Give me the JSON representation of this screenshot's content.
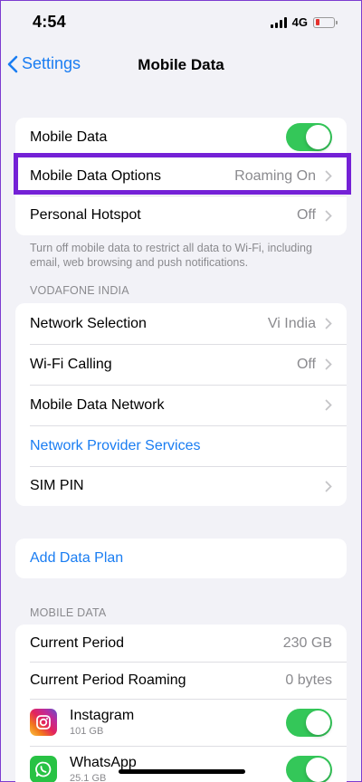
{
  "status_bar": {
    "time": "4:54",
    "network": "4G"
  },
  "nav": {
    "back_label": "Settings",
    "title": "Mobile Data"
  },
  "group1": {
    "rows": [
      {
        "label": "Mobile Data",
        "toggle": "on"
      },
      {
        "label": "Mobile Data Options",
        "value": "Roaming On"
      },
      {
        "label": "Personal Hotspot",
        "value": "Off"
      }
    ],
    "footnote": "Turn off mobile data to restrict all data to Wi-Fi, including email, web browsing and push notifications."
  },
  "carrier_section": {
    "header": "VODAFONE INDIA",
    "rows": [
      {
        "label": "Network Selection",
        "value": "Vi India"
      },
      {
        "label": "Wi-Fi Calling",
        "value": "Off"
      },
      {
        "label": "Mobile Data Network"
      },
      {
        "label": "Network Provider Services"
      },
      {
        "label": "SIM PIN"
      }
    ]
  },
  "data_plan": {
    "label": "Add Data Plan"
  },
  "usage_section": {
    "header": "MOBILE DATA",
    "rows": [
      {
        "label": "Current Period",
        "value": "230 GB"
      },
      {
        "label": "Current Period Roaming",
        "value": "0 bytes"
      }
    ],
    "apps": [
      {
        "name": "Instagram",
        "size": "101 GB",
        "toggle": "on",
        "icon": "instagram-icon"
      },
      {
        "name": "WhatsApp",
        "size": "25.1 GB",
        "toggle": "on",
        "icon": "whatsapp-icon"
      }
    ]
  },
  "colors": {
    "accent": "#1a7df2",
    "toggle_on": "#34c759",
    "highlight": "#7421d6",
    "background": "#f2f2f7"
  }
}
